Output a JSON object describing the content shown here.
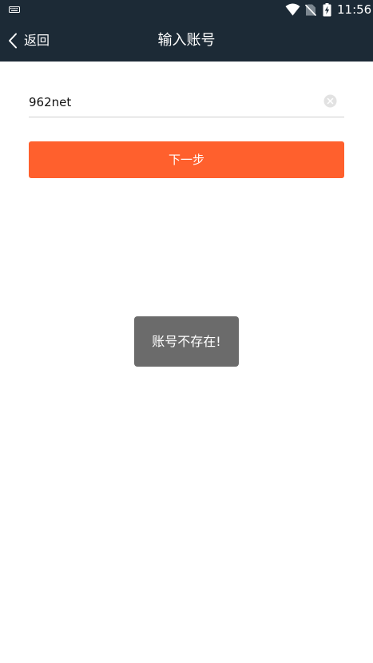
{
  "status_bar": {
    "time": "11:56",
    "icons": [
      "keyboard-icon",
      "wifi-icon",
      "no-sim-icon",
      "battery-charging-icon"
    ]
  },
  "title_bar": {
    "back_label": "返回",
    "title": "输入账号",
    "background_color": "#1c2a36"
  },
  "form": {
    "account_value": "962net",
    "clear_icon": "clear-circle-icon",
    "next_label": "下一步",
    "next_color": "#ff602d"
  },
  "toast": {
    "message": "账号不存在!"
  }
}
